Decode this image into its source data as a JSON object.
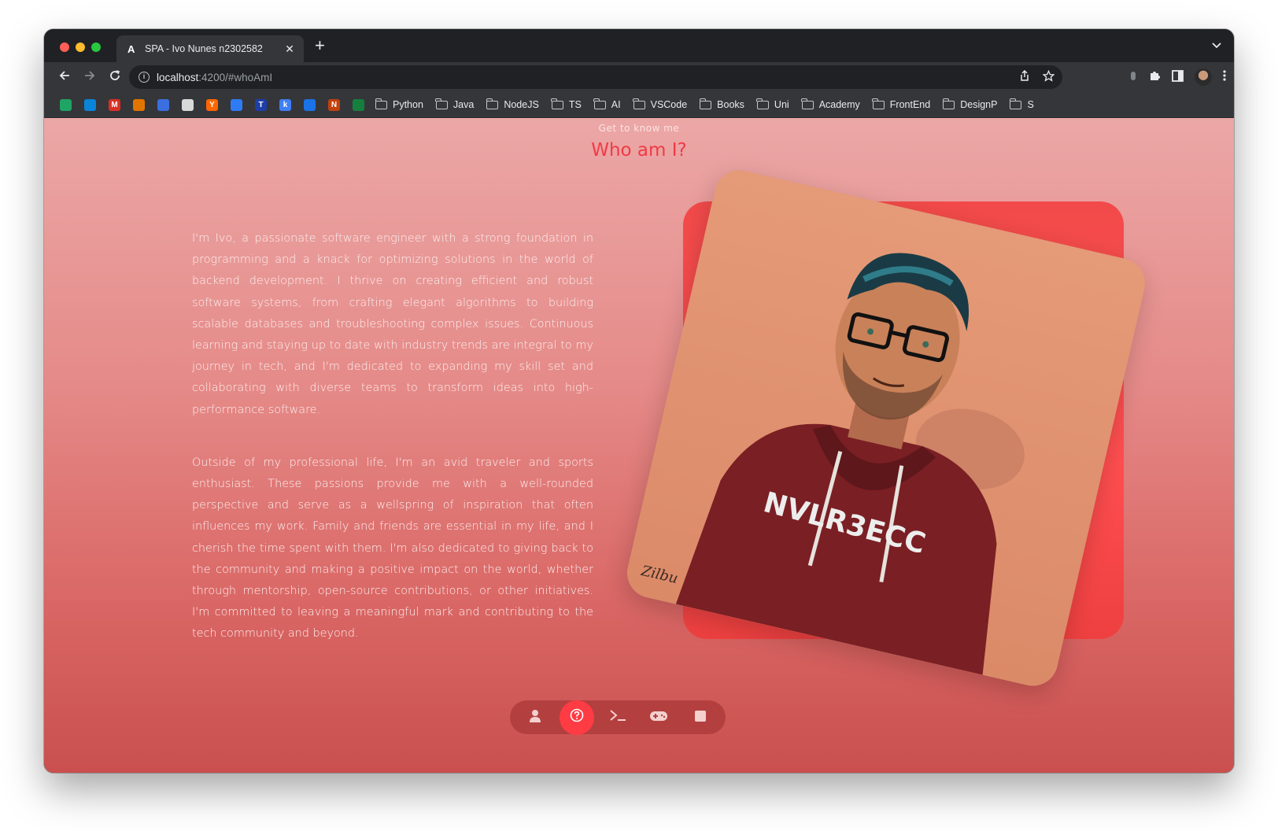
{
  "browser": {
    "tab": {
      "favicon": "A",
      "title": "SPA - Ivo Nunes n2302582",
      "close": "✕"
    },
    "new_tab": "+",
    "tabs_menu": "⌄",
    "url_host": "localhost",
    "url_rest": ":4200/#whoAmI",
    "bookmarks": [
      {
        "label": "Python"
      },
      {
        "label": "Java"
      },
      {
        "label": "NodeJS"
      },
      {
        "label": "TS"
      },
      {
        "label": "AI"
      },
      {
        "label": "VSCode"
      },
      {
        "label": "Books"
      },
      {
        "label": "Uni"
      },
      {
        "label": "Academy"
      },
      {
        "label": "FrontEnd"
      },
      {
        "label": "DesignP"
      },
      {
        "label": "S"
      }
    ],
    "bookmark_favicons": [
      {
        "letter": "",
        "color": "#1fa463"
      },
      {
        "letter": "",
        "color": "#0a84d8"
      },
      {
        "letter": "M",
        "color": "#d93025"
      },
      {
        "letter": "",
        "color": "#e37400"
      },
      {
        "letter": "",
        "color": "#3b6fe0"
      },
      {
        "letter": "",
        "color": "#d9d9d9"
      },
      {
        "letter": "Y",
        "color": "#ff6600"
      },
      {
        "letter": "",
        "color": "#2f7bf6"
      },
      {
        "letter": "T",
        "color": "#1e3ea8"
      },
      {
        "letter": "k",
        "color": "#3f7ef5"
      },
      {
        "letter": "",
        "color": "#1a73e8"
      },
      {
        "letter": "N",
        "color": "#c2410c"
      },
      {
        "letter": "",
        "color": "#15803d"
      }
    ]
  },
  "page": {
    "eyebrow": "Get to know me",
    "heading": "Who am I?",
    "paragraph_1": "I'm Ivo, a passionate software engineer with a strong foundation in programming and a knack for optimizing solutions in the world of backend development. I thrive on creating efficient and robust software systems, from crafting elegant algorithms to building scalable databases and troubleshooting complex issues. Continuous learning and staying up to date with industry trends are integral to my journey in tech, and I'm dedicated to expanding my skill set and collaborating with diverse teams to transform ideas into high-performance software.",
    "paragraph_2": "Outside of my professional life, I'm an avid traveler and sports enthusiast. These passions provide me with a well-rounded perspective and serve as a wellspring of inspiration that often influences my work. Family and friends are essential in my life, and I cherish the time spent with them. I'm also dedicated to giving back to the community and making a positive impact on the world, whether through mentorship, open-source contributions, or other initiatives. I'm committed to leaving a meaningful mark and contributing to the tech community and beyond.",
    "portrait_signature": "Zilbu",
    "portrait_hoodie_text": "NVLR3ECC"
  },
  "dock": {
    "items": [
      {
        "name": "user-icon",
        "glyph": "👤",
        "active": false
      },
      {
        "name": "question-icon",
        "glyph": "?",
        "active": true
      },
      {
        "name": "terminal-icon",
        "glyph": ">_",
        "active": false
      },
      {
        "name": "gamepad-icon",
        "glyph": "🎮",
        "active": false
      },
      {
        "name": "stop-icon",
        "glyph": "■",
        "active": false
      }
    ]
  },
  "colors": {
    "accent": "#f03a47",
    "active_dock": "#ff3b43"
  }
}
